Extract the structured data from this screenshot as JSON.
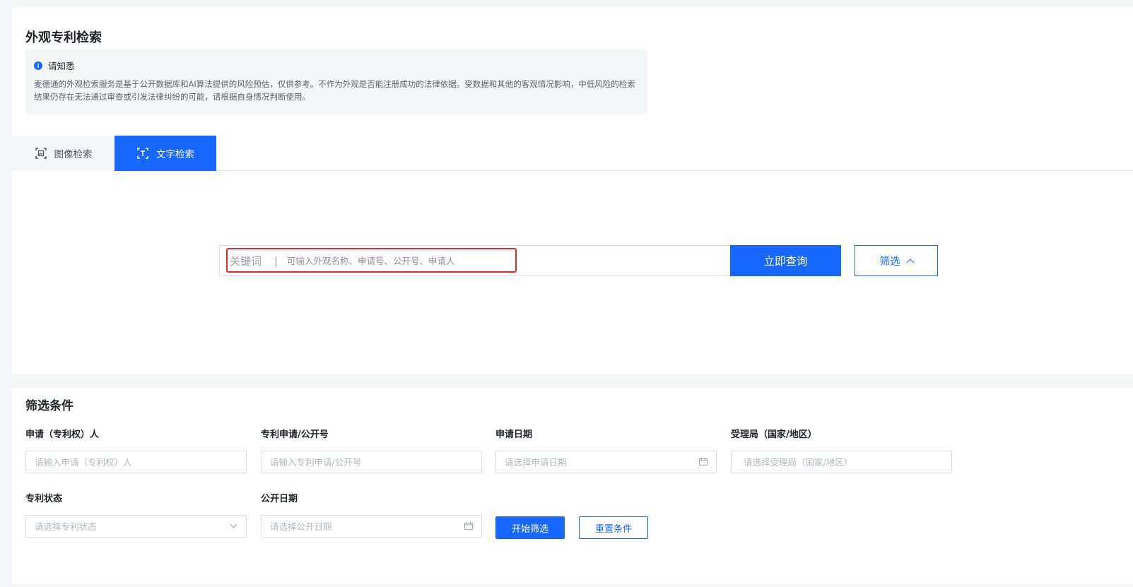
{
  "page": {
    "title": "外观专利检索"
  },
  "notice": {
    "title": "请知悉",
    "body": "麦德通的外观检索服务是基于公开数据库和AI算法提供的风险预估，仅供参考。不作为外观是否能注册成功的法律依据。受数据和其他的客观情况影响，中低风险的检索结果仍存在无法通过审查或引发法律纠纷的可能，请根据自身情况判断使用。",
    "icon": "info-icon"
  },
  "tabs": [
    {
      "label": "图像检索",
      "icon": "image-scan-icon",
      "active": false
    },
    {
      "label": "文字检索",
      "icon": "text-scan-icon",
      "active": true
    }
  ],
  "search": {
    "label": "关键词",
    "separator": "|",
    "placeholder": "可输入外观名称、申请号、公开号、申请人",
    "query_button": "立即查询",
    "filter_button": "筛选"
  },
  "filter": {
    "title": "筛选条件",
    "fields": [
      {
        "label": "申请（专利权）人",
        "placeholder": "请输入申请（专利权）人",
        "type": "text"
      },
      {
        "label": "专利申请/公开号",
        "placeholder": "请输入专利申请/公开号",
        "type": "text"
      },
      {
        "label": "申请日期",
        "placeholder": "请选择申请日期",
        "type": "date"
      },
      {
        "label": "受理局（国家/地区）",
        "placeholder": "请选择受理局（国家/地区）",
        "type": "text"
      },
      {
        "label": "专利状态",
        "placeholder": "请选择专利状态",
        "type": "select"
      },
      {
        "label": "公开日期",
        "placeholder": "请选择公开日期",
        "type": "date"
      }
    ],
    "start_button": "开始筛选",
    "reset_button": "重置条件"
  },
  "colors": {
    "primary": "#1668ff",
    "highlight": "#e5262a"
  }
}
